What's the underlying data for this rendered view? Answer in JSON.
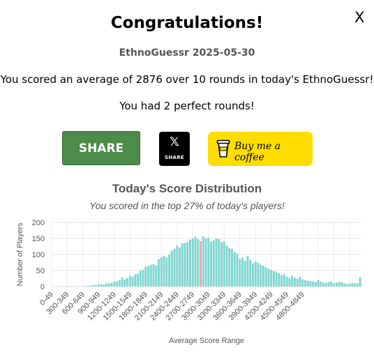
{
  "dialog": {
    "close_label": "X",
    "title": "Congratulations!",
    "subtitle": "EthnoGuessr 2025-05-30",
    "score_line": "You scored an average of 2876 over 10 rounds in today's EthnoGuessr!",
    "perfect_line": "You had 2 perfect rounds!"
  },
  "buttons": {
    "share_label": "SHARE",
    "x_icon": "x-logo-icon",
    "x_label": "SHARE",
    "coffee_icon": "coffee-cup-icon",
    "coffee_label": "Buy me a coffee"
  },
  "colors": {
    "share_green": "#4c8b4a",
    "coffee_yellow": "#ffdd00",
    "bar_fill": "#7fd6d0",
    "bar_highlight": "#f2a0b5"
  },
  "chart_data": {
    "type": "bar",
    "title": "Today's Score Distribution",
    "subtitle": "You scored in the top 27% of today's players!",
    "xlabel": "Average Score Range",
    "ylabel": "Number of Players",
    "ylim": [
      0,
      200
    ],
    "yticks": [
      0,
      50,
      100,
      150,
      200
    ],
    "grid": true,
    "highlight_index": 57,
    "tick_labels": [
      "0-49",
      "300-349",
      "600-649",
      "900-949",
      "1200-1249",
      "1500-1549",
      "1800-1849",
      "2100-2149",
      "2400-2449",
      "2700-2749",
      "3000-3049",
      "3300-3349",
      "3600-3649",
      "3900-3949",
      "4200-4249",
      "4500-4549",
      "4800-4849"
    ],
    "tick_every": 6,
    "values": [
      0,
      0,
      0,
      0,
      1,
      0,
      1,
      0,
      1,
      0,
      0,
      0,
      1,
      2,
      2,
      3,
      5,
      4,
      8,
      7,
      6,
      9,
      10,
      12,
      15,
      16,
      20,
      28,
      22,
      26,
      33,
      30,
      38,
      40,
      50,
      52,
      61,
      64,
      68,
      70,
      66,
      85,
      92,
      95,
      90,
      100,
      112,
      118,
      128,
      122,
      135,
      136,
      138,
      146,
      150,
      155,
      148,
      142,
      156,
      150,
      152,
      140,
      144,
      150,
      148,
      138,
      140,
      128,
      120,
      117,
      108,
      102,
      85,
      90,
      80,
      95,
      82,
      72,
      78,
      74,
      68,
      65,
      60,
      55,
      52,
      48,
      45,
      42,
      35,
      38,
      30,
      26,
      33,
      28,
      24,
      30,
      22,
      20,
      18,
      17,
      16,
      14,
      20,
      15,
      12,
      12,
      14,
      16,
      10,
      12,
      14,
      13,
      10,
      8,
      9,
      11,
      10,
      10,
      28
    ]
  }
}
